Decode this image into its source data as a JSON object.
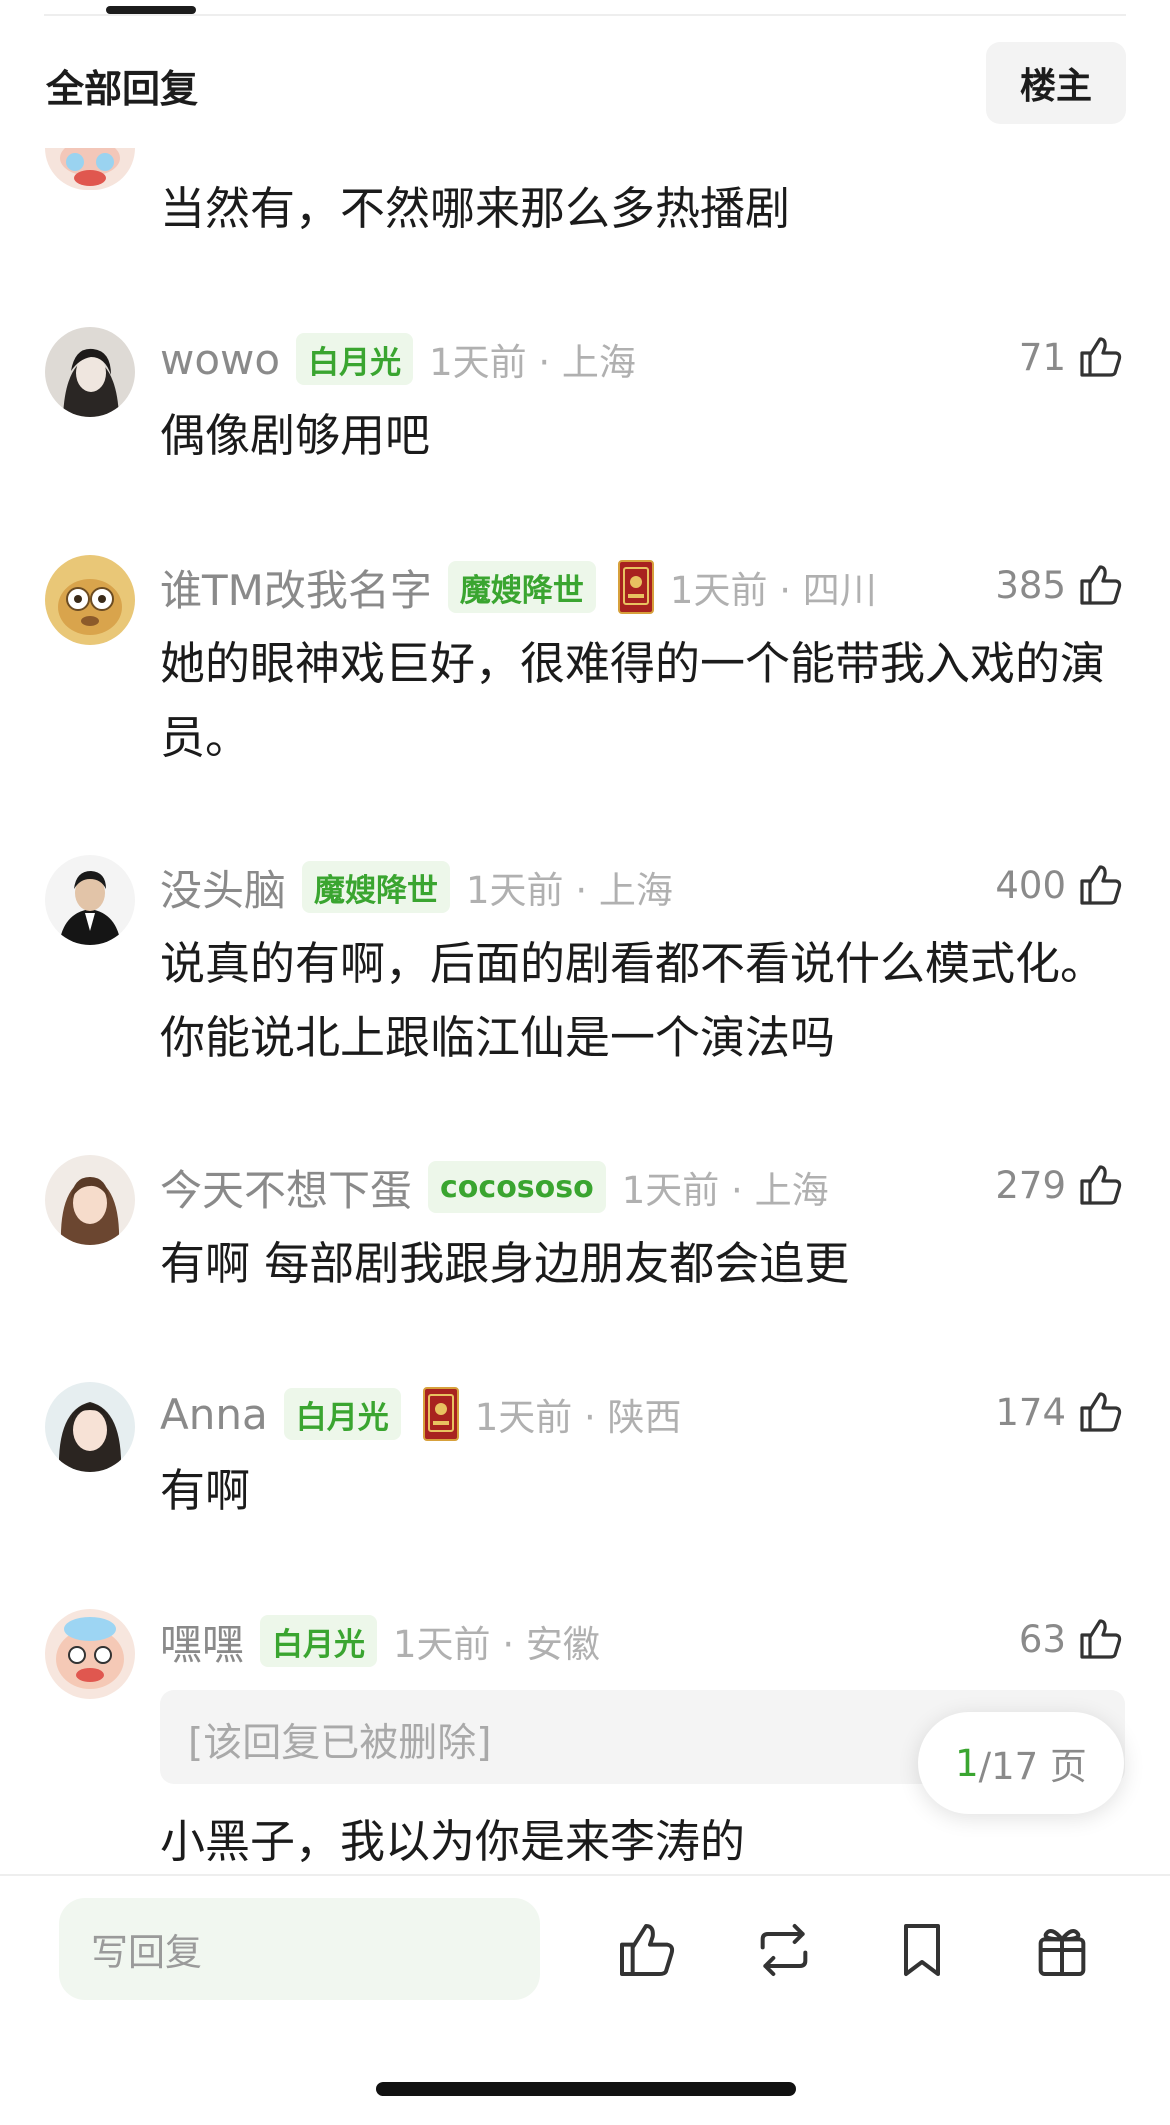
{
  "header": {
    "title": "全部回复",
    "op_button": "楼主"
  },
  "first_comment": {
    "text": "当然有，不然哪来那么多热播剧"
  },
  "comments": [
    {
      "username": "wowo",
      "badge": "白月光",
      "has_medal": false,
      "time": "1天前 · 上海",
      "likes": "71",
      "text": "偶像剧够用吧"
    },
    {
      "username": "谁TM改我名字",
      "badge": "魔嫂降世",
      "has_medal": true,
      "time": "1天前 · 四川",
      "likes": "385",
      "text": "她的眼神戏巨好，很难得的一个能带我入戏的演员。"
    },
    {
      "username": "没头脑",
      "badge": "魔嫂降世",
      "has_medal": false,
      "time": "1天前 · 上海",
      "likes": "400",
      "text": "说真的有啊，后面的剧看都不看说什么模式化。你能说北上跟临江仙是一个演法吗"
    },
    {
      "username": "今天不想下蛋",
      "badge": "cocososo",
      "has_medal": false,
      "time": "1天前 · 上海",
      "likes": "279",
      "text": "有啊 每部剧我跟身边朋友都会追更"
    },
    {
      "username": "Anna",
      "badge": "白月光",
      "has_medal": true,
      "time": "1天前 · 陕西",
      "likes": "174",
      "text": "有啊"
    },
    {
      "username": "嘿嘿",
      "badge": "白月光",
      "has_medal": false,
      "time": "1天前 · 安徽",
      "likes": "63",
      "deleted_quote": "[该回复已被删除]",
      "text": "小黑子，我以为你是来李涛的"
    }
  ],
  "pagination": {
    "current": "1",
    "total": "/17 页"
  },
  "bottom_bar": {
    "reply_placeholder": "写回复",
    "actions": [
      "like-icon",
      "repost-icon",
      "bookmark-icon",
      "gift-icon"
    ]
  },
  "colors": {
    "accent_green": "#3aa530",
    "badge_bg": "#edf7ea",
    "meta_gray": "#8a8a8a",
    "time_gray": "#b0b0b0"
  }
}
